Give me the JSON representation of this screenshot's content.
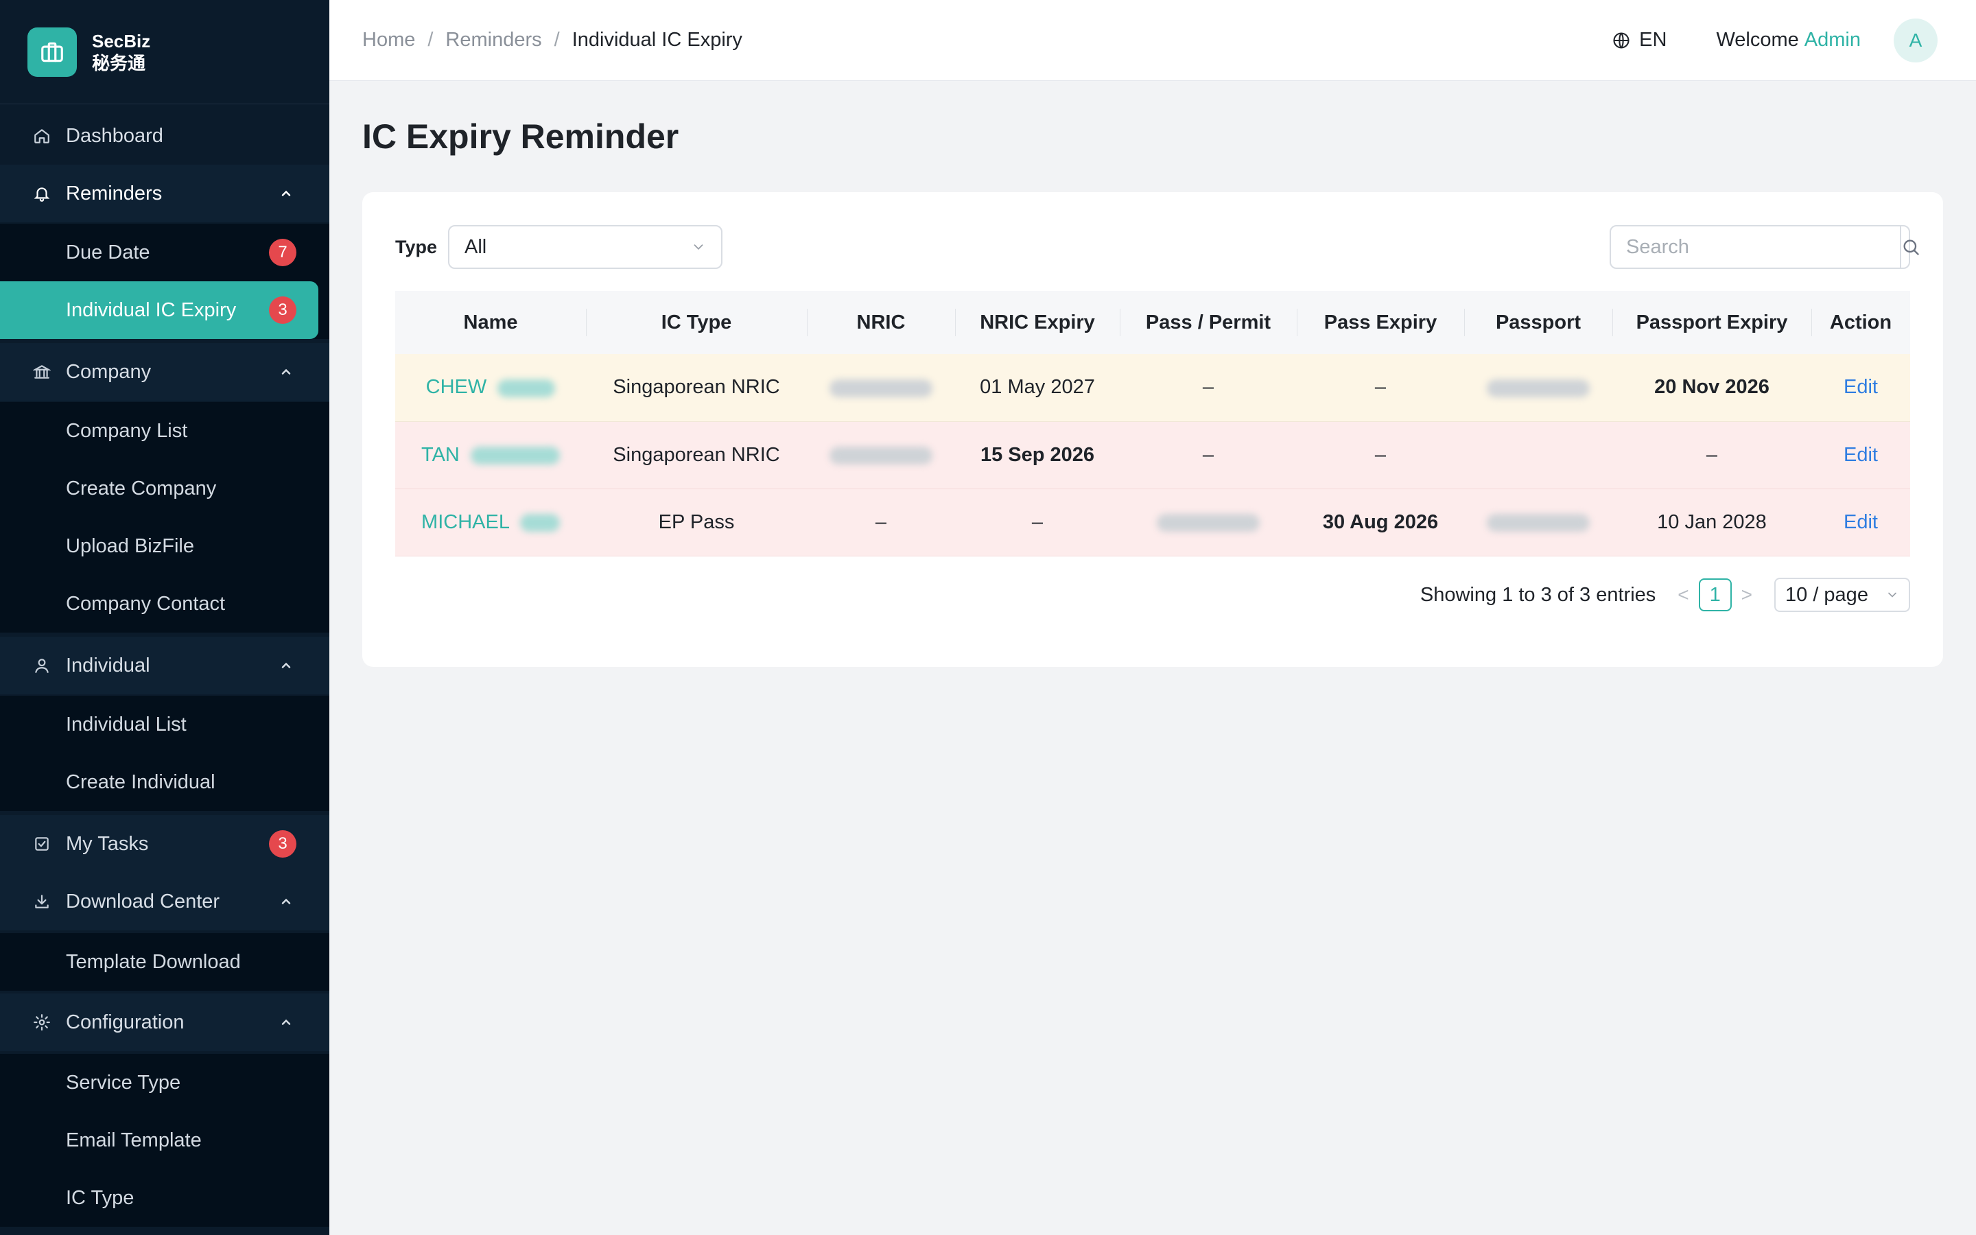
{
  "brand": {
    "name": "SecBiz",
    "subtitle": "秘务通"
  },
  "sidebar": {
    "dashboard": "Dashboard",
    "reminders": "Reminders",
    "due_date": "Due Date",
    "due_date_badge": "7",
    "individual_ic_expiry": "Individual IC Expiry",
    "ic_expiry_badge": "3",
    "company": "Company",
    "company_list": "Company List",
    "create_company": "Create Company",
    "upload_bizfile": "Upload BizFile",
    "company_contact": "Company Contact",
    "individual": "Individual",
    "individual_list": "Individual List",
    "create_individual": "Create Individual",
    "my_tasks": "My Tasks",
    "my_tasks_badge": "3",
    "download_center": "Download Center",
    "template_download": "Template Download",
    "configuration": "Configuration",
    "service_type": "Service Type",
    "email_template": "Email Template",
    "ic_type": "IC Type"
  },
  "header": {
    "breadcrumb": [
      "Home",
      "Reminders",
      "Individual IC Expiry"
    ],
    "language": "EN",
    "welcome": "Welcome",
    "user": "Admin",
    "avatar_initial": "A"
  },
  "page": {
    "title": "IC Expiry Reminder"
  },
  "filters": {
    "type_label": "Type",
    "type_value": "All",
    "search_placeholder": "Search"
  },
  "table": {
    "columns": [
      "Name",
      "IC Type",
      "NRIC",
      "NRIC Expiry",
      "Pass / Permit",
      "Pass Expiry",
      "Passport",
      "Passport Expiry",
      "Action"
    ],
    "rows": [
      {
        "name": "CHEW",
        "ic_type": "Singaporean NRIC",
        "nric_expiry": "01 May 2027",
        "pass_permit": "–",
        "pass_expiry": "–",
        "passport_expiry": "20 Nov 2026",
        "action": "Edit"
      },
      {
        "name": "TAN",
        "ic_type": "Singaporean NRIC",
        "nric_expiry": "15 Sep 2026",
        "pass_permit": "–",
        "pass_expiry": "–",
        "passport_expiry": "–",
        "action": "Edit"
      },
      {
        "name": "MICHAEL",
        "ic_type": "EP Pass",
        "nric": "–",
        "nric_expiry": "–",
        "pass_expiry": "30 Aug 2026",
        "passport_expiry": "10 Jan 2028",
        "action": "Edit"
      }
    ]
  },
  "pagination": {
    "summary": "Showing 1 to 3 of 3 entries",
    "current_page": "1",
    "page_size": "10 / page",
    "prev": "<",
    "next": ">"
  },
  "colors": {
    "accent": "#2fb3a6",
    "sidebar_bg": "#0b1b2b",
    "danger": "#d4252b",
    "warning": "#d9780f",
    "link": "#2f7de1"
  },
  "icons": {
    "brand": "briefcase-icon",
    "dashboard": "home-icon",
    "reminders": "bell-icon",
    "company": "bank-icon",
    "individual": "user-icon",
    "my_tasks": "checkbox-icon",
    "download_center": "download-icon",
    "configuration": "gear-icon",
    "language": "globe-icon",
    "search": "search-icon"
  }
}
